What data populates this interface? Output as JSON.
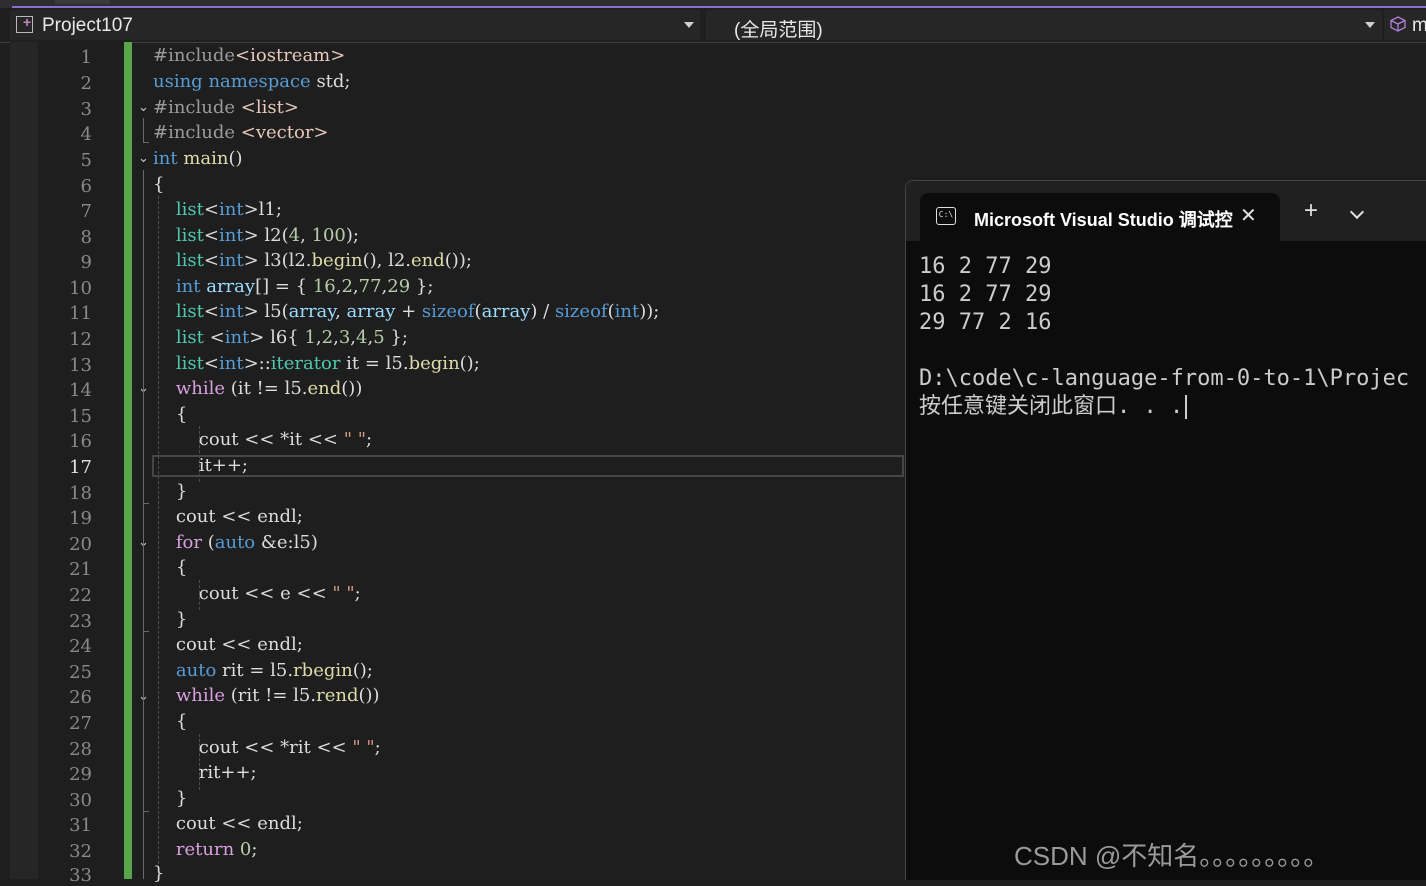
{
  "navbar": {
    "project": "Project107",
    "scope": "(全局范围)",
    "member_prefix": "m"
  },
  "editor": {
    "active_line": 17,
    "line_numbers": [
      "1",
      "2",
      "3",
      "4",
      "5",
      "6",
      "7",
      "8",
      "9",
      "10",
      "11",
      "12",
      "13",
      "14",
      "15",
      "16",
      "17",
      "18",
      "19",
      "20",
      "21",
      "22",
      "23",
      "24",
      "25",
      "26",
      "27",
      "28",
      "29",
      "30",
      "31",
      "32",
      "33"
    ],
    "lines": [
      "#include<iostream>",
      "using namespace std;",
      "#include <list>",
      "#include <vector>",
      "int main()",
      "{",
      "    list<int>l1;",
      "    list<int> l2(4, 100);",
      "    list<int> l3(l2.begin(), l2.end());",
      "    int array[] = { 16,2,77,29 };",
      "    list<int> l5(array, array + sizeof(array) / sizeof(int));",
      "    list <int> l6{ 1,2,3,4,5 };",
      "    list<int>::iterator it = l5.begin();",
      "    while (it != l5.end())",
      "    {",
      "        cout << *it << \" \";",
      "        it++;",
      "    }",
      "    cout << endl;",
      "    for (auto &e:l5)",
      "    {",
      "        cout << e << \" \";",
      "    }",
      "    cout << endl;",
      "    auto rit = l5.rbegin();",
      "    while (rit != l5.rend())",
      "    {",
      "        cout << *rit << \" \";",
      "        rit++;",
      "    }",
      "    cout << endl;",
      "    return 0;",
      "}"
    ]
  },
  "console": {
    "icon_text": "C:\\",
    "tab_title": "Microsoft Visual Studio 调试控",
    "close_glyph": "✕",
    "plus_glyph": "+",
    "output": [
      "16 2 77 29",
      "16 2 77 29",
      "29 77 2 16",
      "",
      "D:\\code\\c-language-from-0-to-1\\Projec",
      "按任意键关闭此窗口. . ."
    ]
  },
  "watermark": "CSDN @不知名。。。。。。。。。",
  "colors": {
    "keyword": "#569cd6",
    "control": "#d8a0df",
    "type": "#4ec9b0",
    "function": "#dcdcaa",
    "number": "#b5cea8",
    "string": "#d69d85",
    "variable": "#9cdcfe",
    "change_bar": "#57a64a",
    "accent": "#8a6cd1"
  },
  "icons": [
    "project-icon",
    "dropdown-arrow-icon",
    "cube-icon",
    "fold-icon",
    "terminal-icon",
    "close-icon",
    "plus-icon",
    "chevron-down-icon"
  ]
}
